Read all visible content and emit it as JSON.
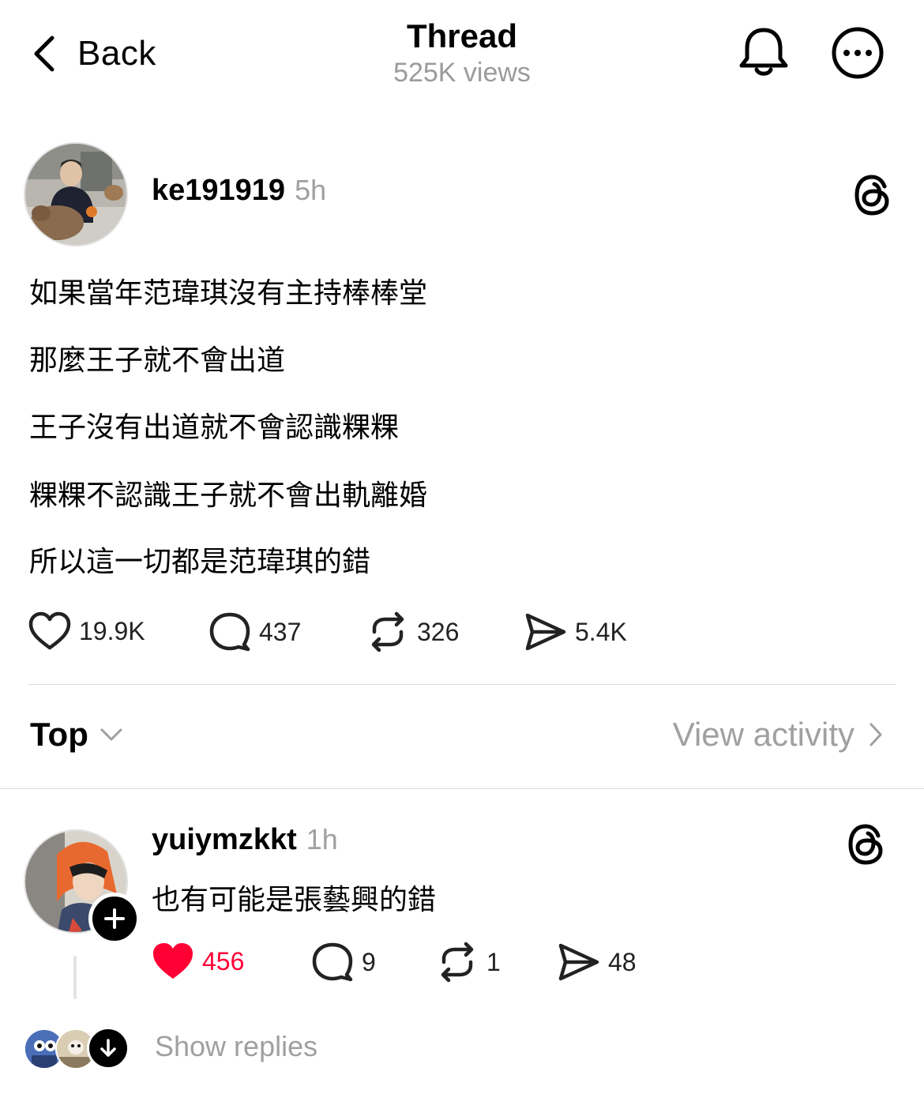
{
  "header": {
    "back_label": "Back",
    "title": "Thread",
    "views": "525K views"
  },
  "post": {
    "username": "ke191919",
    "time": "5h",
    "lines": [
      "如果當年范瑋琪沒有主持棒棒堂",
      "那麼王子就不會出道",
      "王子沒有出道就不會認識粿粿",
      "粿粿不認識王子就不會出軌離婚",
      "所以這一切都是范瑋琪的錯"
    ],
    "stats": {
      "likes": "19.9K",
      "comments": "437",
      "reposts": "326",
      "shares": "5.4K"
    }
  },
  "sort": {
    "label": "Top",
    "view_activity": "View activity"
  },
  "reply": {
    "username": "yuiymzkkt",
    "time": "1h",
    "text": "也有可能是張藝興的錯",
    "stats": {
      "likes": "456",
      "comments": "9",
      "reposts": "1",
      "shares": "48"
    },
    "show_replies": "Show replies"
  },
  "colors": {
    "like_active": "#ff0034",
    "muted": "#a0a0a0"
  },
  "icons": [
    "chevron-left-icon",
    "bell-icon",
    "more-icon",
    "threads-logo-icon",
    "heart-icon",
    "comment-icon",
    "repost-icon",
    "share-icon",
    "chevron-down-icon",
    "chevron-right-icon",
    "plus-icon",
    "arrow-down-icon"
  ]
}
